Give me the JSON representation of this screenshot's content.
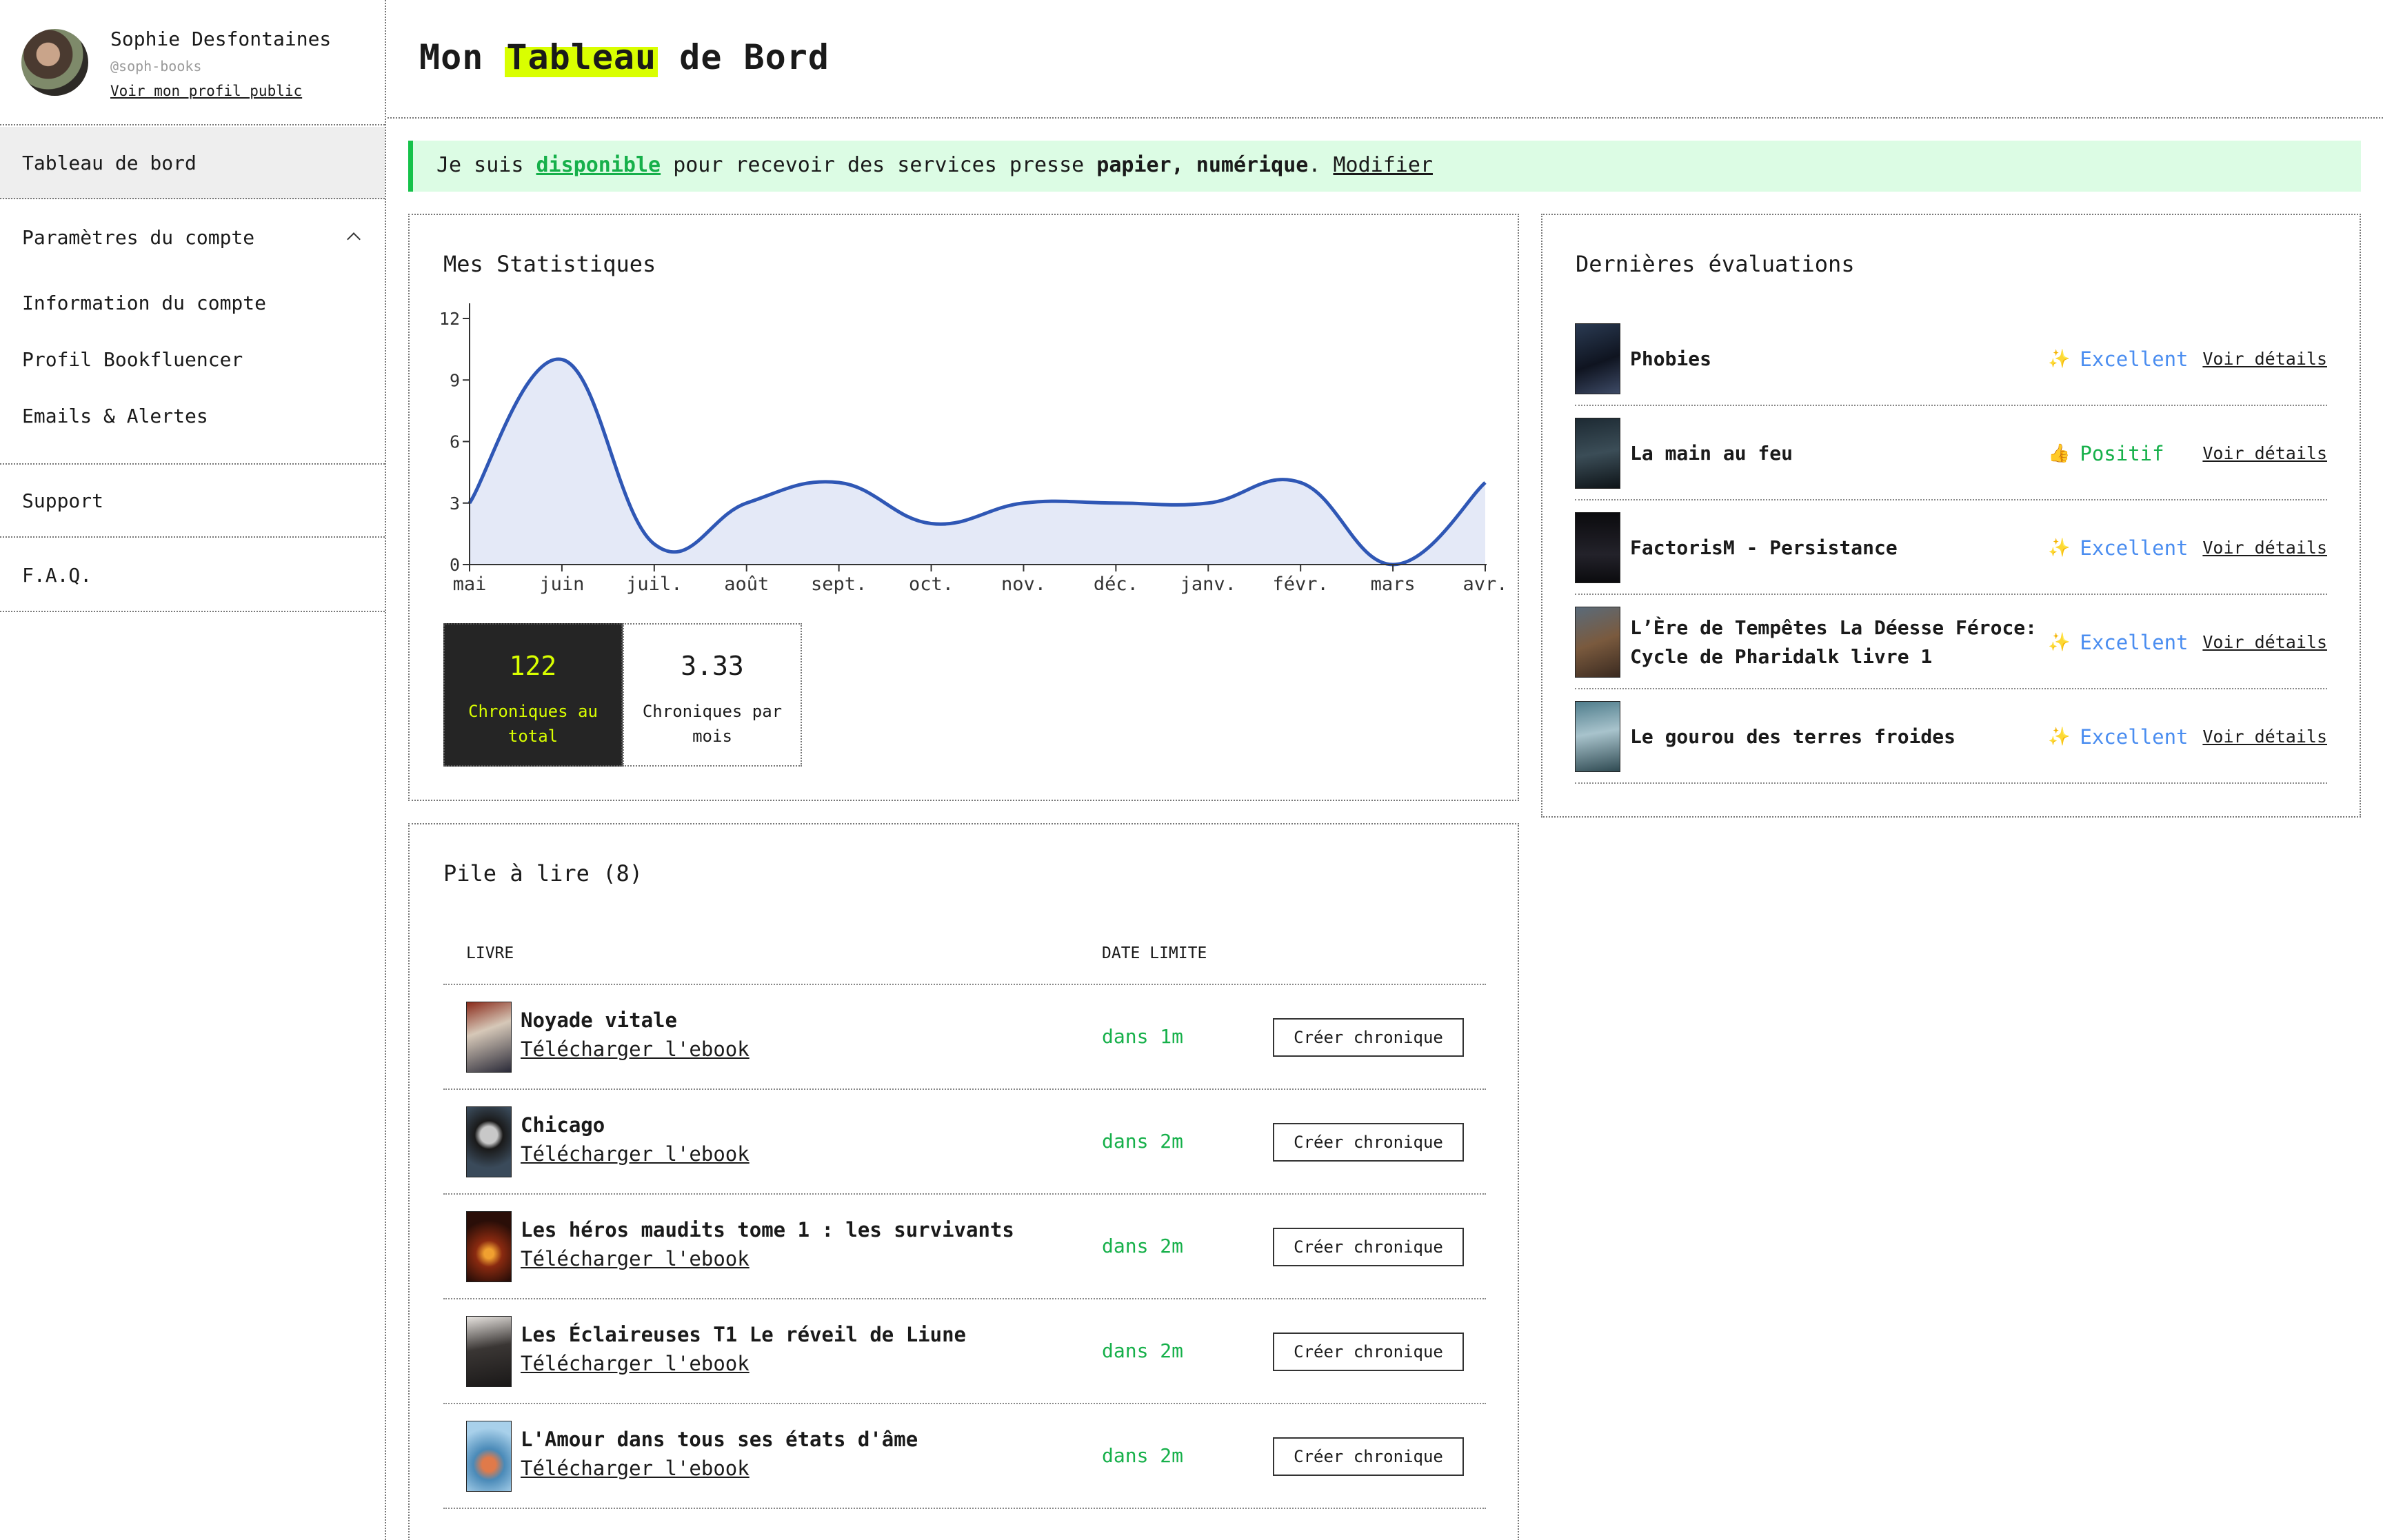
{
  "profile": {
    "name": "Sophie Desfontaines",
    "handle": "@soph-books",
    "public_link": "Voir mon profil public"
  },
  "nav": {
    "dashboard": "Tableau de bord",
    "account_settings": "Paramètres du compte",
    "sub_items": [
      "Information du compte",
      "Profil Bookfluencer",
      "Emails & Alertes"
    ],
    "support": "Support",
    "faq": "F.A.Q."
  },
  "header": {
    "title_before": "Mon",
    "title_highlight": "Tableau",
    "title_after": "de Bord"
  },
  "banner": {
    "text_1": "Je suis",
    "status": "disponible",
    "text_2": "pour recevoir des services presse",
    "formats": "papier, numérique",
    "text_3": ".",
    "modify_link": "Modifier"
  },
  "stats": {
    "title": "Mes Statistiques",
    "total_value": "122",
    "total_label": "Chroniques au total",
    "avg_value": "3.33",
    "avg_label": "Chroniques par mois"
  },
  "chart_data": {
    "type": "area",
    "x": [
      "mai",
      "juin",
      "juil.",
      "août",
      "sept.",
      "oct.",
      "nov.",
      "déc.",
      "janv.",
      "févr.",
      "mars",
      "avr."
    ],
    "values": [
      3,
      10,
      1,
      3,
      4,
      2,
      3,
      3,
      3,
      4,
      0,
      4
    ],
    "yticks": [
      0,
      3,
      6,
      9,
      12
    ],
    "ylim": [
      0,
      12
    ],
    "title": "",
    "xlabel": "",
    "ylabel": "",
    "line_color": "#2f57b5",
    "fill_color": "#e4e9f7"
  },
  "evaluations": {
    "title": "Dernières évaluations",
    "link_label": "Voir détails",
    "items": [
      {
        "title": "Phobies",
        "grade": "Excellent",
        "icon": "sparkles-icon",
        "color": "#4a8df0"
      },
      {
        "title": "La main au feu",
        "grade": "Positif",
        "icon": "thumbs-up-icon",
        "color": "#16b04a"
      },
      {
        "title": "FactorisM - Persistance",
        "grade": "Excellent",
        "icon": "sparkles-icon",
        "color": "#4a8df0"
      },
      {
        "title": "L’Ère de Tempêtes La Déesse Féroce: Cycle de Pharidalk livre 1",
        "grade": "Excellent",
        "icon": "sparkles-icon",
        "color": "#4a8df0"
      },
      {
        "title": "Le gourou des terres froides",
        "grade": "Excellent",
        "icon": "sparkles-icon",
        "color": "#4a8df0"
      }
    ]
  },
  "pile": {
    "title": "Pile à lire (8)",
    "col_book": "LIVRE",
    "col_deadline": "DATE LIMITE",
    "download_label": "Télécharger l'ebook",
    "button_label": "Créer chronique",
    "items": [
      {
        "title": "Noyade vitale",
        "due": "dans 1m"
      },
      {
        "title": "Chicago",
        "due": "dans 2m"
      },
      {
        "title": "Les héros maudits tome 1 : les survivants",
        "due": "dans 2m"
      },
      {
        "title": "Les Éclaireuses T1 Le réveil de Liune",
        "due": "dans 2m"
      },
      {
        "title": "L'Amour dans tous ses états d'âme",
        "due": "dans 2m"
      }
    ]
  }
}
